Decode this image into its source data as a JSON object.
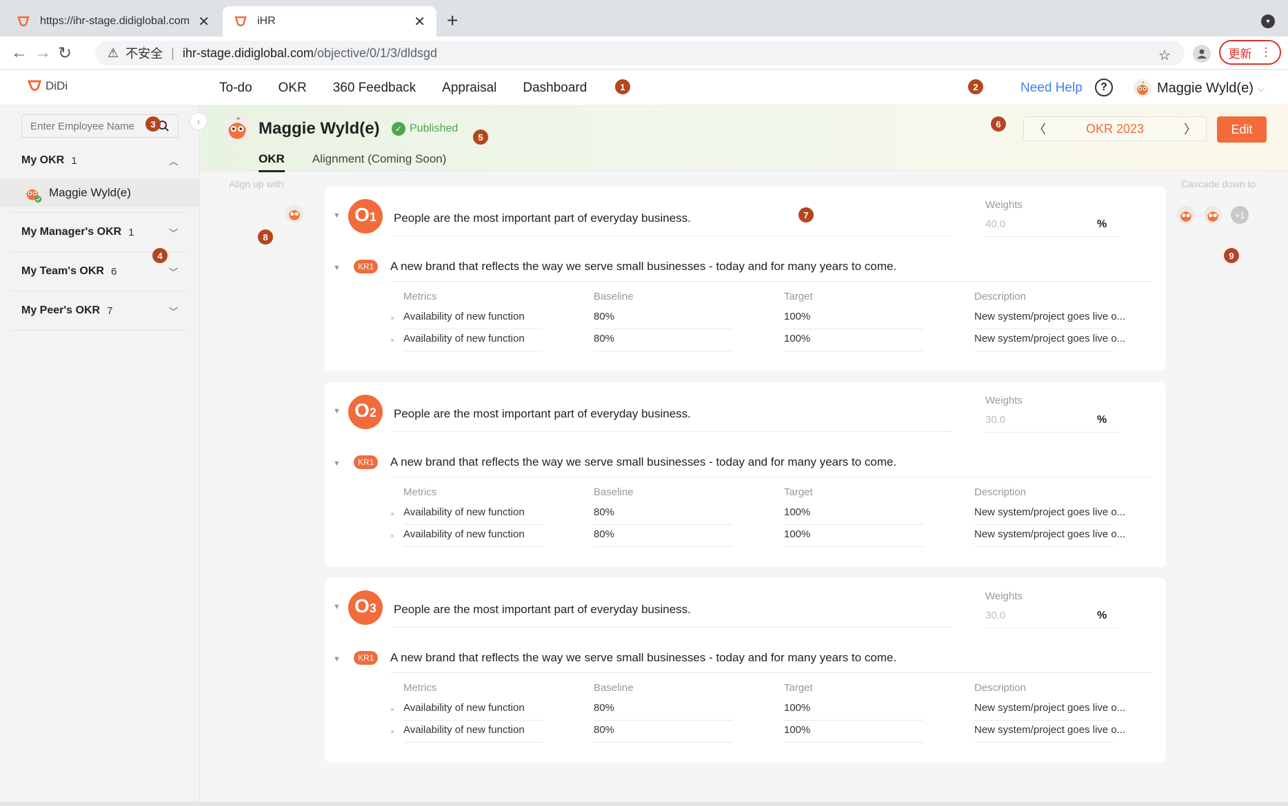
{
  "browser": {
    "tabs": [
      {
        "title": "https://ihr-stage.didiglobal.com"
      },
      {
        "title": "iHR"
      }
    ],
    "new_tab": "+",
    "url_warning": "不安全",
    "url_host": "ihr-stage.didiglobal.com",
    "url_path": "/objective/0/1/3/dldsgd",
    "update_label": "更新"
  },
  "header": {
    "logo": "DiDi",
    "nav": [
      "To-do",
      "OKR",
      "360 Feedback",
      "Appraisal",
      "Dashboard"
    ],
    "need_help": "Need Help",
    "user_name": "Maggie Wyld(e)"
  },
  "annotations": [
    "1",
    "2",
    "3",
    "4",
    "5",
    "6",
    "7",
    "8",
    "9"
  ],
  "sidebar": {
    "search_placeholder": "Enter Employee Name",
    "sections": [
      {
        "label": "My OKR",
        "count": "1"
      },
      {
        "label": "My Manager's OKR",
        "count": "1"
      },
      {
        "label": "My Team's OKR",
        "count": "6"
      },
      {
        "label": "My Peer's OKR",
        "count": "7"
      }
    ],
    "selected_item": "Maggie Wyld(e)"
  },
  "profile": {
    "name": "Maggie Wyld(e)",
    "status": "Published",
    "tabs": [
      "OKR",
      "Alignment (Coming Soon)"
    ],
    "period": "OKR 2023",
    "edit_label": "Edit"
  },
  "columns": {
    "align_up": "Align up with",
    "cascade_down": "Cascade down to",
    "plus_more": "+1"
  },
  "objectives": [
    {
      "letter": "O",
      "num": "1",
      "text": "People are the most important part of everyday business.",
      "weights_label": "Weights",
      "weight": "40.0",
      "pct": "%",
      "kr_badge": "KR1",
      "kr_text": "A new brand that reflects the way we serve small businesses - today and for many years to come.",
      "headers": [
        "Metrics",
        "Baseline",
        "Target",
        "Description"
      ],
      "rows": [
        [
          "Availability of new function",
          "80%",
          "100%",
          "New system/project goes live o..."
        ],
        [
          "Availability of new function",
          "80%",
          "100%",
          "New system/project goes live o..."
        ]
      ]
    },
    {
      "letter": "O",
      "num": "2",
      "text": "People are the most important part of everyday business.",
      "weights_label": "Weights",
      "weight": "30.0",
      "pct": "%",
      "kr_badge": "KR1",
      "kr_text": "A new brand that reflects the way we serve small businesses - today and for many years to come.",
      "headers": [
        "Metrics",
        "Baseline",
        "Target",
        "Description"
      ],
      "rows": [
        [
          "Availability of new function",
          "80%",
          "100%",
          "New system/project goes live o..."
        ],
        [
          "Availability of new function",
          "80%",
          "100%",
          "New system/project goes live o..."
        ]
      ]
    },
    {
      "letter": "O",
      "num": "3",
      "text": "People are the most important part of everyday business.",
      "weights_label": "Weights",
      "weight": "30.0",
      "pct": "%",
      "kr_badge": "KR1",
      "kr_text": "A new brand that reflects the way we serve small businesses - today and for many years to come.",
      "headers": [
        "Metrics",
        "Baseline",
        "Target",
        "Description"
      ],
      "rows": [
        [
          "Availability of new function",
          "80%",
          "100%",
          "New system/project goes live o..."
        ],
        [
          "Availability of new function",
          "80%",
          "100%",
          "New system/project goes live o..."
        ]
      ]
    }
  ],
  "colors": {
    "accent": "#f26b3a",
    "link": "#3d7ff5",
    "published": "#52a451",
    "annotation": "#b4461f"
  }
}
